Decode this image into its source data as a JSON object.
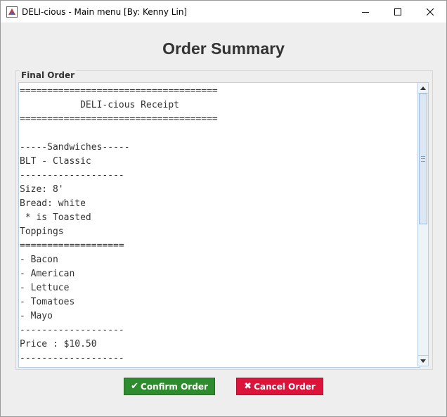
{
  "window": {
    "title": "DELI-cious - Main menu [By: Kenny Lin]",
    "controls": [
      "minimize-icon",
      "maximize-icon",
      "close-icon"
    ]
  },
  "heading": "Order Summary",
  "final_order": {
    "label": "Final Order",
    "receipt": "====================================\n           DELI-cious Receipt\n====================================\n\n-----Sandwiches-----\nBLT - Classic\n-------------------\nSize: 8'\nBread: white\n * is Toasted\nToppings\n===================\n- Bacon\n- American\n- Lettuce\n- Tomatoes\n- Mayo\n-------------------\nPrice : $10.50\n-------------------"
  },
  "buttons": {
    "confirm_icon": "✔",
    "confirm_label": "Confirm Order",
    "cancel_icon": "✖",
    "cancel_label": "Cancel Order"
  },
  "colors": {
    "confirm": "#2e8b2e",
    "cancel": "#dc143c",
    "heading": "#333333"
  }
}
